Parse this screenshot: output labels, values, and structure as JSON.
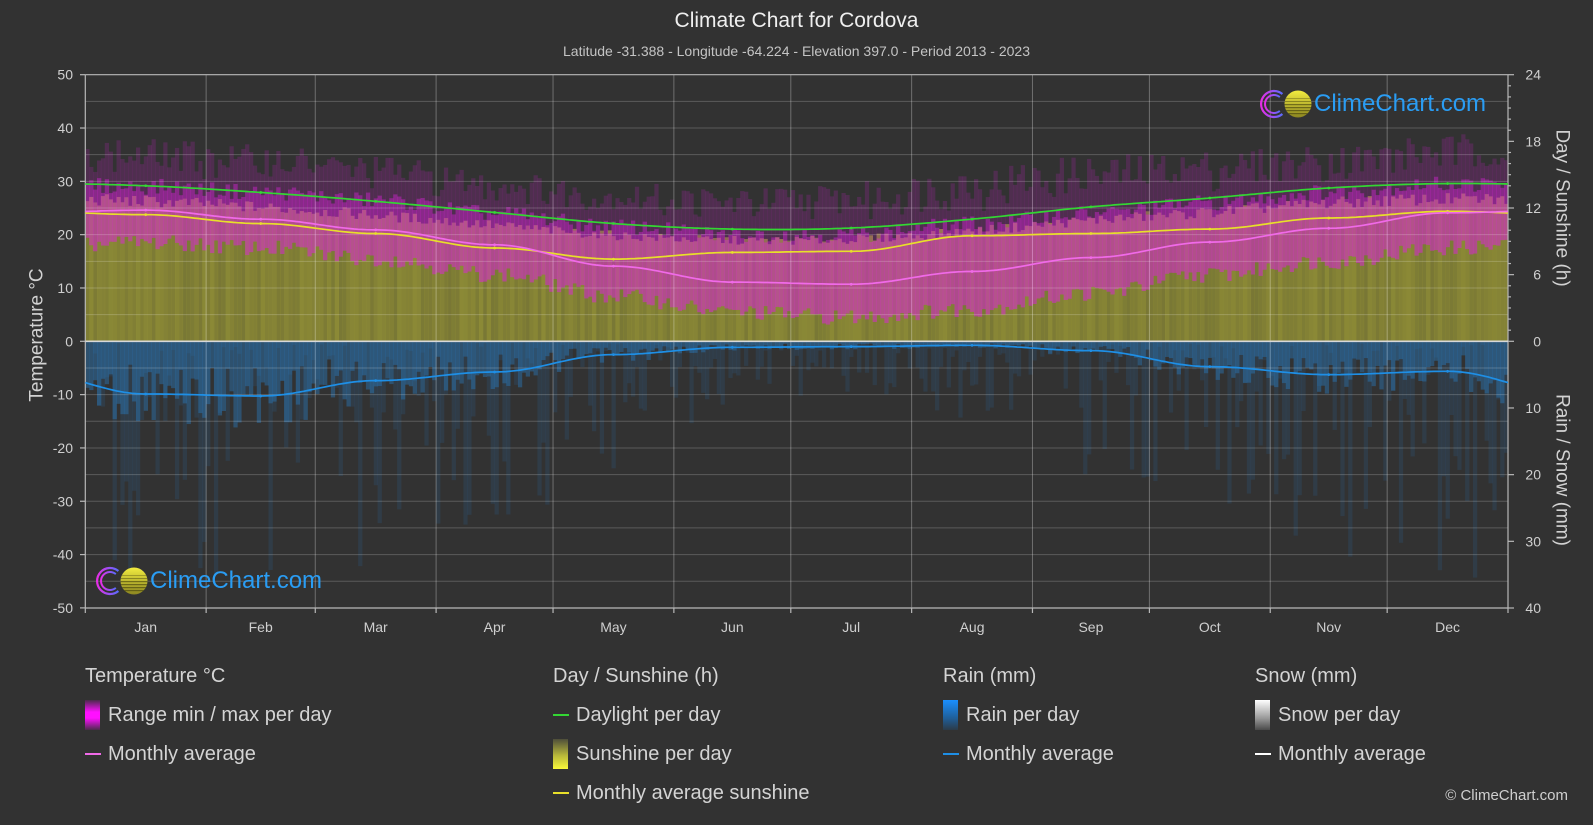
{
  "page": {
    "title": "Climate Chart for Cordova",
    "subtitle": "Latitude -31.388 - Longitude -64.224 - Elevation 397.0 - Period 2013 - 2023"
  },
  "logo": {
    "text": "ClimeChart.com",
    "icon": "climechart-logo-icon"
  },
  "copyright": "© ClimeChart.com",
  "legend": {
    "groups": [
      {
        "title": "Temperature °C",
        "items": [
          {
            "label": "Range min / max per day",
            "swatch": "gradient-box",
            "color": "#ff10ff"
          },
          {
            "label": "Monthly average",
            "swatch": "line",
            "color": "#f06ae8"
          }
        ]
      },
      {
        "title": "Day / Sunshine (h)",
        "items": [
          {
            "label": "Daylight per day",
            "swatch": "line",
            "color": "#33d633"
          },
          {
            "label": "Sunshine per day",
            "swatch": "gradient-box",
            "color": "#f8f83a"
          },
          {
            "label": "Monthly average sunshine",
            "swatch": "line",
            "color": "#e8df2a"
          }
        ]
      },
      {
        "title": "Rain (mm)",
        "items": [
          {
            "label": "Rain per day",
            "swatch": "gradient-box",
            "color": "#1a8fff"
          },
          {
            "label": "Monthly average",
            "swatch": "line",
            "color": "#1e8fe6"
          }
        ]
      },
      {
        "title": "Snow (mm)",
        "items": [
          {
            "label": "Snow per day",
            "swatch": "gradient-box",
            "color": "#ffffff"
          },
          {
            "label": "Monthly average",
            "swatch": "line",
            "color": "#ffffff"
          }
        ]
      }
    ]
  },
  "chart_data": {
    "type": "line",
    "title": "Climate Chart for Cordova",
    "subtitle": "Latitude -31.388 - Longitude -64.224 - Elevation 397.0 - Period 2013 - 2023",
    "categories": [
      "Jan",
      "Feb",
      "Mar",
      "Apr",
      "May",
      "Jun",
      "Jul",
      "Aug",
      "Sep",
      "Oct",
      "Nov",
      "Dec"
    ],
    "month_days": [
      31,
      28,
      31,
      30,
      31,
      30,
      31,
      31,
      30,
      31,
      30,
      31
    ],
    "axes": {
      "left": {
        "label": "Temperature °C",
        "range": [
          -50,
          50
        ],
        "ticks": [
          50,
          40,
          30,
          20,
          10,
          0,
          -10,
          -20,
          -30,
          -40,
          -50
        ]
      },
      "right_top": {
        "label": "Day / Sunshine (h)",
        "range": [
          0,
          24
        ],
        "ticks": [
          24,
          18,
          12,
          6,
          0
        ]
      },
      "right_bottom": {
        "label": "Rain / Snow (mm)",
        "range": [
          0,
          40
        ],
        "ticks": [
          10,
          20,
          30,
          40
        ]
      }
    },
    "grid": true,
    "legend_position": "bottom",
    "series": [
      {
        "id": "daylight",
        "name": "Daylight per day",
        "unit": "h",
        "axis": "right_top",
        "color": "#33d633",
        "values": [
          14.0,
          13.4,
          12.6,
          11.6,
          10.6,
          10.1,
          10.2,
          11.0,
          12.1,
          12.9,
          13.8,
          14.2
        ]
      },
      {
        "id": "sunshine_avg",
        "name": "Monthly average sunshine",
        "unit": "h",
        "axis": "right_top",
        "color": "#e8df2a",
        "values": [
          11.4,
          10.6,
          9.7,
          8.4,
          7.4,
          8.0,
          8.1,
          9.5,
          9.7,
          10.1,
          11.1,
          11.7
        ]
      },
      {
        "id": "temp_avg",
        "name": "Temperature monthly average",
        "unit": "°C",
        "axis": "left",
        "color": "#f06ae8",
        "values": [
          24.6,
          22.9,
          20.9,
          18.1,
          14.1,
          11.1,
          10.7,
          13.1,
          15.7,
          18.6,
          21.2,
          24.1
        ]
      },
      {
        "id": "rain_avg",
        "name": "Rain monthly average",
        "unit": "mm",
        "axis": "right_bottom",
        "color": "#1e8fe6",
        "values": [
          7.9,
          8.2,
          5.9,
          4.6,
          2.0,
          0.9,
          0.8,
          0.6,
          1.4,
          3.8,
          5.0,
          4.5
        ]
      },
      {
        "id": "temp_range",
        "name": "Range min / max per day",
        "unit": "°C",
        "axis": "left",
        "color": "#e020e0",
        "max": [
          29.0,
          28.0,
          26.5,
          24.0,
          21.5,
          20.0,
          20.0,
          22.0,
          24.0,
          26.0,
          28.0,
          29.5
        ],
        "min": [
          18.5,
          17.5,
          15.5,
          12.5,
          8.5,
          5.5,
          4.5,
          6.0,
          9.0,
          12.5,
          15.0,
          17.5
        ],
        "extreme_max": [
          38,
          37,
          35,
          32,
          30,
          29,
          30,
          33,
          35,
          36,
          37,
          39
        ]
      },
      {
        "id": "sunshine_daily",
        "name": "Sunshine per day",
        "unit": "h",
        "axis": "right_top",
        "color": "#8d8b36"
      },
      {
        "id": "rain_daily",
        "name": "Rain per day",
        "unit": "mm",
        "axis": "right_bottom",
        "color": "#2b78b8",
        "extent": [
          38,
          36,
          34,
          30,
          20,
          10,
          8,
          12,
          20,
          28,
          32,
          36
        ]
      }
    ]
  }
}
